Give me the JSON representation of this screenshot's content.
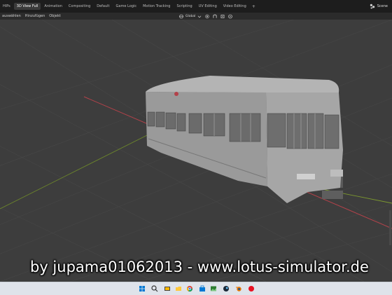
{
  "workspace_tabs": [
    "HIPs",
    "3D View Full",
    "Animation",
    "Compositing",
    "Default",
    "Game Logic",
    "Motion Tracking",
    "Scripting",
    "UV Editing",
    "Video Editing"
  ],
  "active_tab_index": 1,
  "scene_label": "Scene",
  "header_menu": [
    "auswählen",
    "Hinzufügen",
    "Objekt"
  ],
  "transform_orientation": "Global",
  "viewport_label": "",
  "watermark": "by jupama01062013 - www.lotus-simulator.de",
  "colors": {
    "viewport_bg": "#3d3d3d",
    "topbar_bg": "#1d1d1d",
    "x_axis": "#b3424a",
    "y_axis": "#7d9a2f",
    "tram_body": "#9c9c9c"
  },
  "taskbar_icons": [
    "windows-start-icon",
    "search-icon",
    "task-view-icon",
    "file-explorer-icon",
    "store-icon",
    "chrome-icon",
    "photos-icon",
    "steam-icon",
    "blender-icon",
    "record-icon"
  ]
}
